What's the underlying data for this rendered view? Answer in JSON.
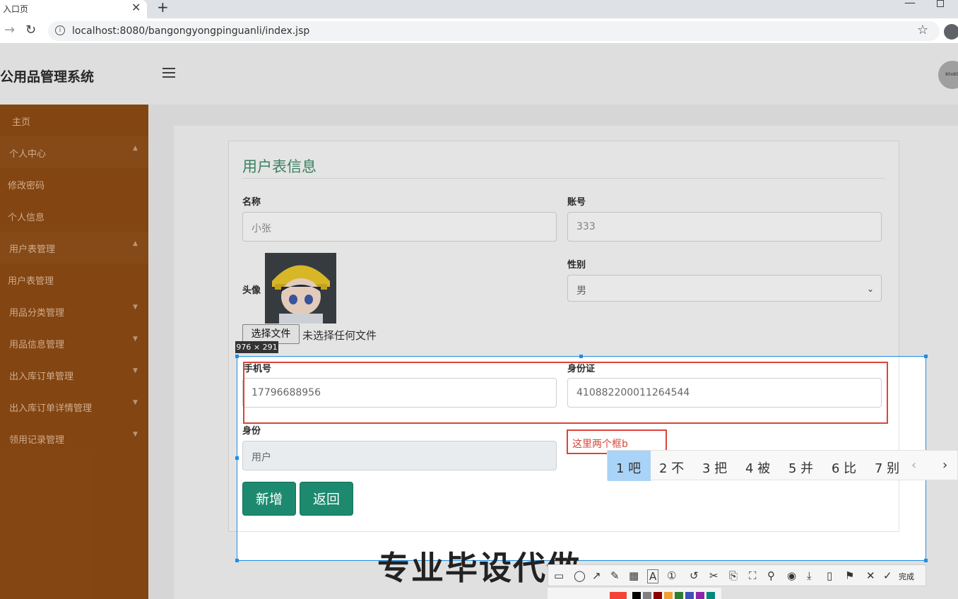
{
  "browser": {
    "tab_title": "入口页",
    "tab_close": "✕",
    "new_tab": "+",
    "url": "localhost:8080/bangongyongpinguanli/index.jsp"
  },
  "header": {
    "title": "公用品管理系统",
    "avatar_text": "80x80"
  },
  "sidebar": {
    "items": [
      {
        "label": "主页"
      },
      {
        "label": "个人中心"
      },
      {
        "label": "修改密码"
      },
      {
        "label": "个人信息"
      },
      {
        "label": "用户表管理"
      },
      {
        "label": "用户表管理"
      },
      {
        "label": "用品分类管理"
      },
      {
        "label": "用品信息管理"
      },
      {
        "label": "出入库订单管理"
      },
      {
        "label": "出入库订单详情管理"
      },
      {
        "label": "领用记录管理"
      }
    ]
  },
  "form": {
    "title": "用户表信息",
    "name_label": "名称",
    "name_value": "小张",
    "account_label": "账号",
    "account_value": "333",
    "avatar_label": "头像",
    "file_button": "选择文件",
    "file_status": "未选择任何文件",
    "gender_label": "性别",
    "gender_value": "男",
    "phone_label": "手机号",
    "phone_value": "17796688956",
    "idcard_label": "身份证",
    "idcard_value": "410882200011264544",
    "role_label": "身份",
    "role_value": "用户",
    "add_button": "新增",
    "back_button": "返回"
  },
  "screenshot_tool": {
    "size_label": "976 × 291",
    "annotation_text": "这里两个框b",
    "done_label": "完成",
    "colors": [
      "#f44336",
      "#000000",
      "#808080",
      "#8b0000",
      "#f0a030",
      "#2e7d32",
      "#3f51b5",
      "#8e24aa",
      "#00897b"
    ]
  },
  "ime": {
    "candidates": [
      "1 吧",
      "2 不",
      "3 把",
      "4 被",
      "5 并",
      "6 比",
      "7 别"
    ]
  },
  "watermark": "专业毕设代做"
}
